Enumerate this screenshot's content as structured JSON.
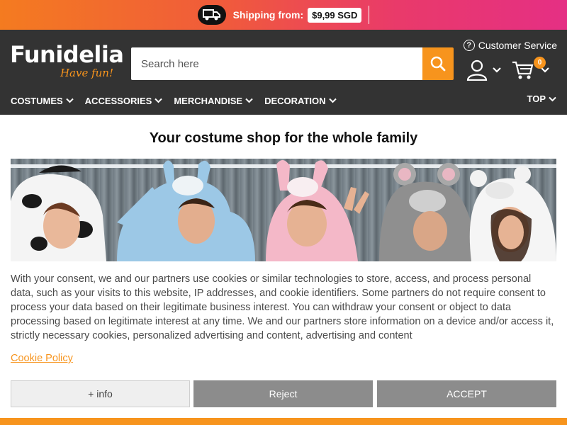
{
  "promo": {
    "text": "Shipping from:",
    "price": "$9,99 SGD"
  },
  "logo": {
    "name": "Funidelia",
    "tagline": "Have fun!"
  },
  "search": {
    "placeholder": "Search here"
  },
  "header": {
    "customer_service": "Customer Service",
    "cart_count": "0"
  },
  "nav": {
    "items": [
      {
        "label": "COSTUMES"
      },
      {
        "label": "ACCESSORIES"
      },
      {
        "label": "MERCHANDISE"
      },
      {
        "label": "DECORATION"
      }
    ],
    "top": "TOP"
  },
  "main": {
    "headline": "Your costume shop for the whole family"
  },
  "cookie": {
    "text": "With your consent, we and our partners use cookies or similar technologies to store, access, and process personal data, such as your visits to this website, IP addresses, and cookie identifiers. Some partners do not require consent to process your data based on their legitimate business interest. You can withdraw your consent or object to data processing based on legitimate interest at any time. We and our partners store information on a device and/or access it, strictly necessary cookies, personalized advertising and content, advertising and content",
    "policy_link": "Cookie Policy",
    "info_button": "+ info",
    "reject_button": "Reject",
    "accept_button": "ACCEPT"
  },
  "colors": {
    "accent": "#f7941d",
    "header_bg": "#333333",
    "promo_start": "#f47b20",
    "promo_end": "#e52f84",
    "button_gray": "#8c8c8c"
  }
}
